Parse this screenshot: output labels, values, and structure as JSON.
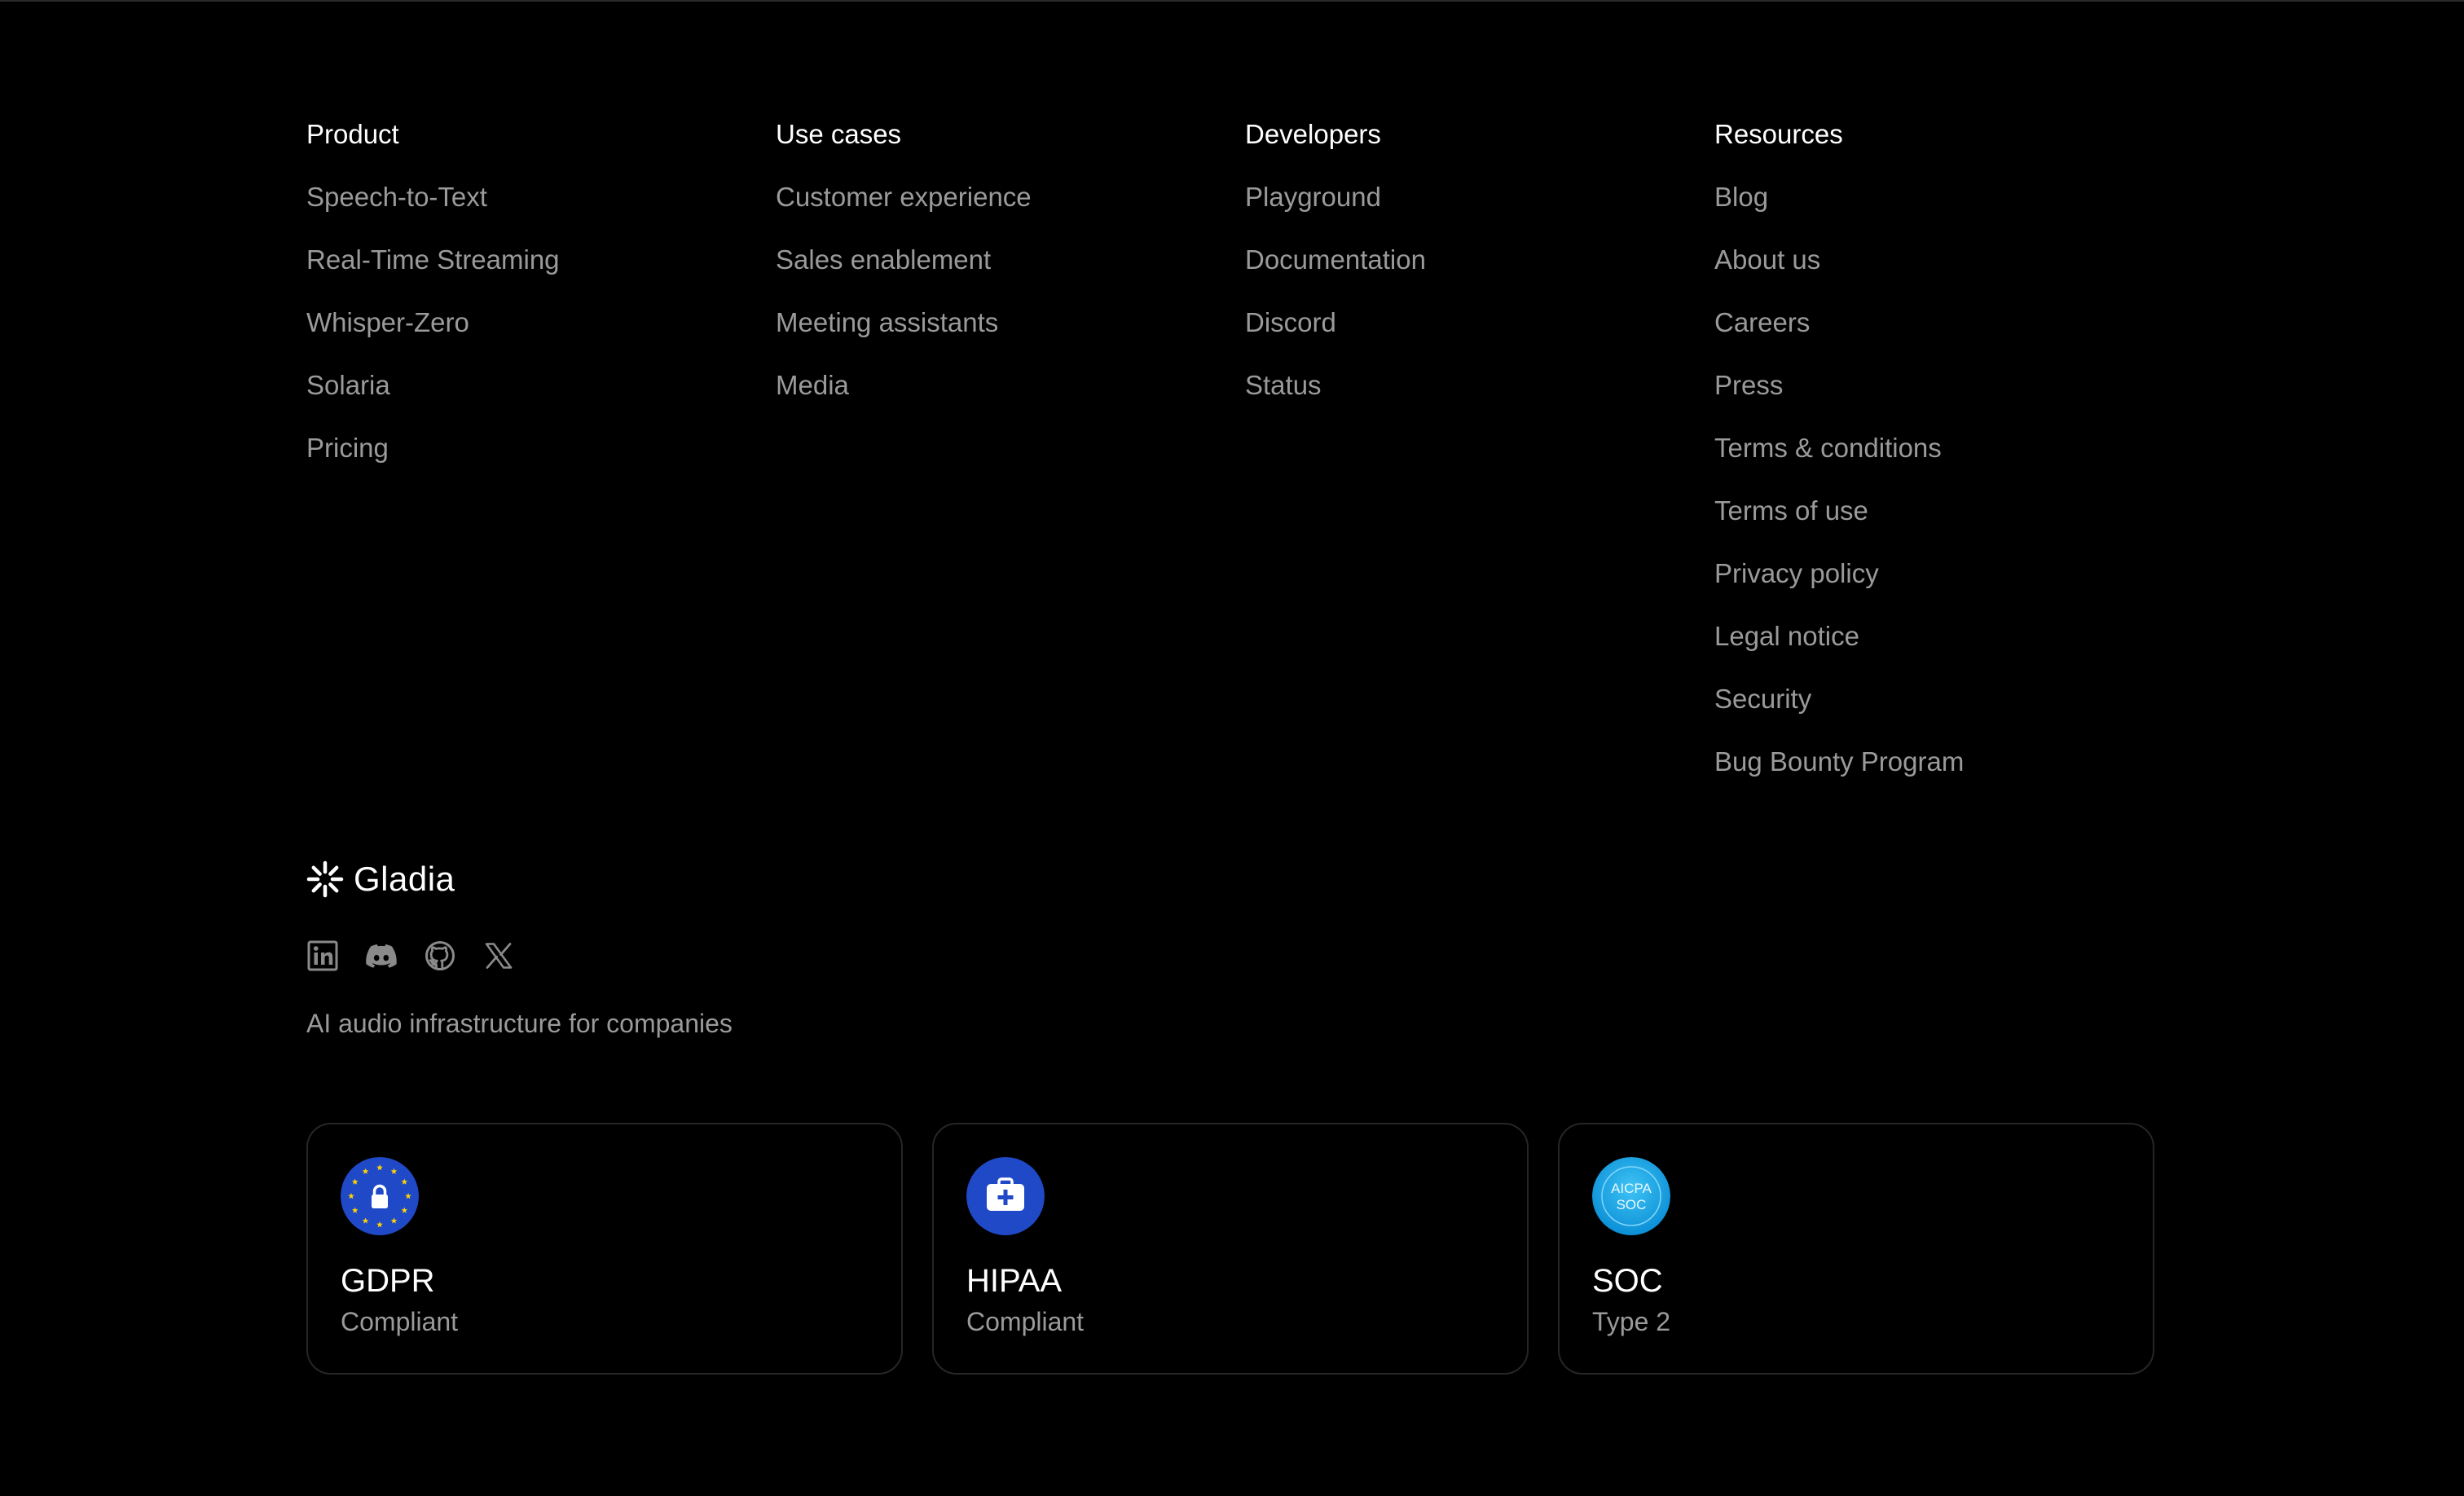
{
  "footer": {
    "columns": [
      {
        "heading": "Product",
        "items": [
          "Speech-to-Text",
          "Real-Time Streaming",
          "Whisper-Zero",
          "Solaria",
          "Pricing"
        ]
      },
      {
        "heading": "Use cases",
        "items": [
          "Customer experience",
          "Sales enablement",
          "Meeting assistants",
          "Media"
        ]
      },
      {
        "heading": "Developers",
        "items": [
          "Playground",
          "Documentation",
          "Discord",
          "Status"
        ]
      },
      {
        "heading": "Resources",
        "items": [
          "Blog",
          "About us",
          "Careers",
          "Press",
          "Terms & conditions",
          "Terms of use",
          "Privacy policy",
          "Legal notice",
          "Security",
          "Bug Bounty Program"
        ]
      }
    ],
    "brand": {
      "name": "Gladia",
      "tagline": "AI audio infrastructure for companies"
    },
    "socials": [
      {
        "icon": "linkedin-icon"
      },
      {
        "icon": "discord-icon"
      },
      {
        "icon": "github-icon"
      },
      {
        "icon": "x-icon"
      }
    ],
    "badges": [
      {
        "title": "GDPR",
        "subtitle": "Compliant",
        "icon": "gdpr-eu-stars-icon",
        "color": "#1f49c7"
      },
      {
        "title": "HIPAA",
        "subtitle": "Compliant",
        "icon": "hipaa-medical-kit-icon",
        "color": "#1f49c7"
      },
      {
        "title": "SOC",
        "subtitle": "Type 2",
        "icon": "aicpa-soc-icon",
        "color": "#19a8e6",
        "icon_text": [
          "AICPA",
          "SOC"
        ]
      }
    ]
  },
  "colors": {
    "background": "#000000",
    "heading": "#ffffff",
    "link": "#9a9a9a",
    "card_border": "#262626"
  }
}
